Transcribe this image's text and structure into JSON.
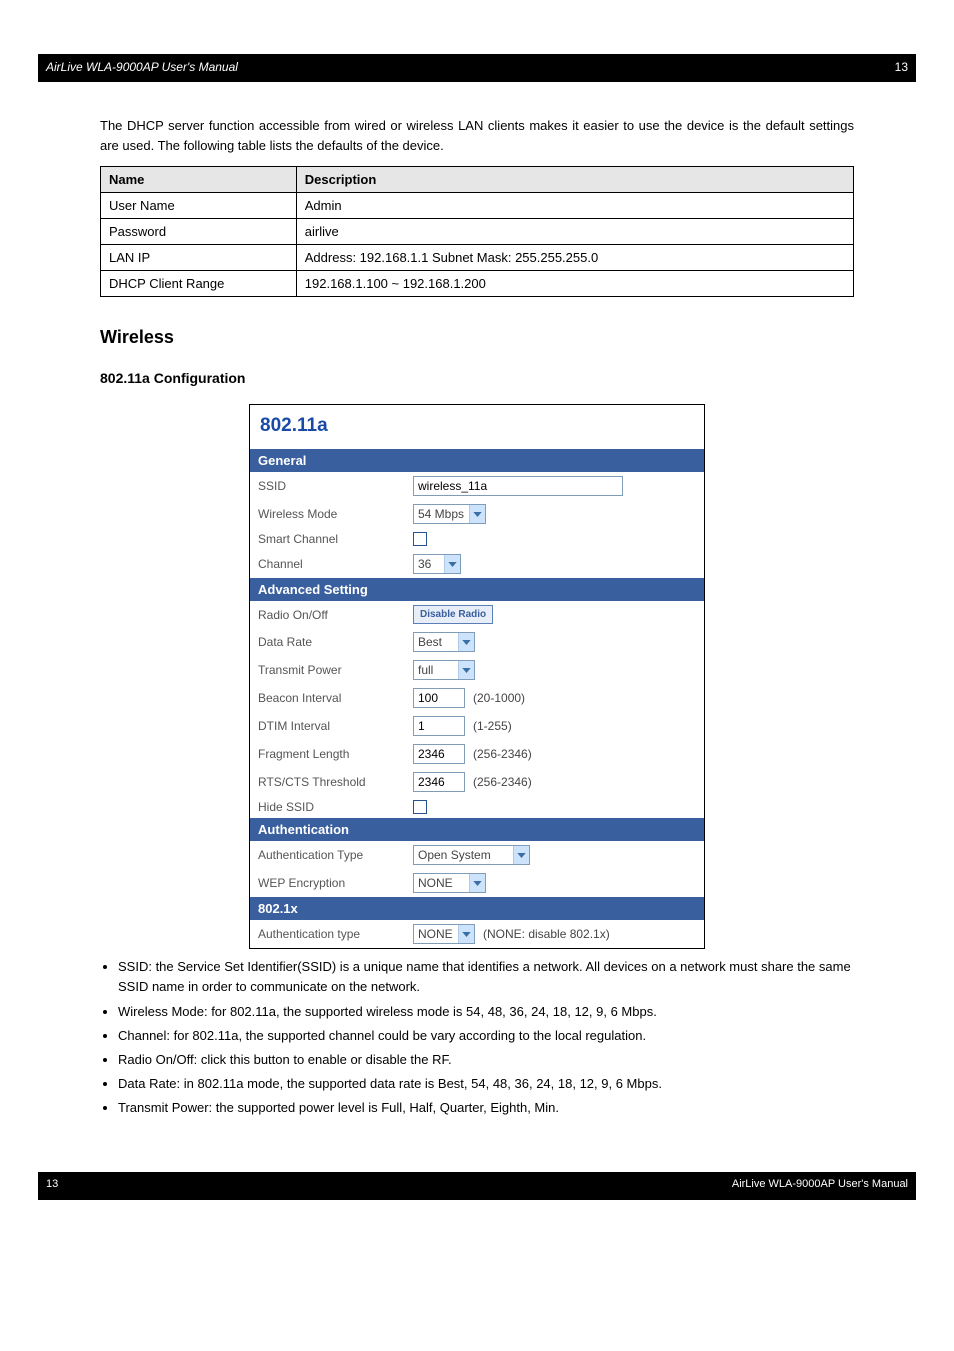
{
  "topbar": {
    "left": "AirLive WLA-9000AP User's Manual",
    "right": "13"
  },
  "bottombar": {
    "left": "13",
    "right": "AirLive WLA-9000AP User's Manual"
  },
  "intro_para": "The DHCP server function accessible from wired or wireless LAN clients makes it easier to use the device is the default settings are used. The following table lists the defaults of the device.",
  "table": {
    "headers": [
      "Name",
      "Description"
    ],
    "rows": [
      [
        "User Name",
        "Admin"
      ],
      [
        "Password",
        "airlive"
      ],
      [
        "LAN IP",
        "Address: 192.168.1.1 Subnet Mask: 255.255.255.0"
      ],
      [
        "DHCP Client Range",
        "192.168.1.100 ~ 192.168.1.200"
      ]
    ]
  },
  "headings": {
    "wireless": "Wireless",
    "a": "802.11a Configuration"
  },
  "panel": {
    "title": "802.11a",
    "sections": {
      "general": {
        "head": "General",
        "rows": {
          "ssid_lbl": "SSID",
          "ssid_val": "wireless_11a",
          "mode_lbl": "Wireless Mode",
          "mode_val": "54 Mbps",
          "smart_lbl": "Smart Channel",
          "chan_lbl": "Channel",
          "chan_val": "36"
        }
      },
      "advanced": {
        "head": "Advanced Setting",
        "rows": {
          "radio_lbl": "Radio On/Off",
          "radio_btn": "Disable Radio",
          "rate_lbl": "Data Rate",
          "rate_val": "Best",
          "power_lbl": "Transmit Power",
          "power_val": "full",
          "beacon_lbl": "Beacon Interval",
          "beacon_val": "100",
          "beacon_note": "(20-1000)",
          "dtim_lbl": "DTIM Interval",
          "dtim_val": "1",
          "dtim_note": "(1-255)",
          "frag_lbl": "Fragment Length",
          "frag_val": "2346",
          "frag_note": "(256-2346)",
          "rts_lbl": "RTS/CTS Threshold",
          "rts_val": "2346",
          "rts_note": "(256-2346)",
          "hide_lbl": "Hide SSID"
        }
      },
      "auth": {
        "head": "Authentication",
        "rows": {
          "authtype_lbl": "Authentication Type",
          "authtype_val": "Open System",
          "wep_lbl": "WEP Encryption",
          "wep_val": "NONE"
        }
      },
      "dot1x": {
        "head": "802.1x",
        "rows": {
          "authtype_lbl": "Authentication type",
          "authtype_val": "NONE",
          "authtype_note": "(NONE: disable 802.1x)"
        }
      }
    }
  },
  "bullets": [
    "SSID: the Service Set Identifier(SSID) is a unique name that identifies a network. All devices on a network must share the same SSID name in order to communicate on the network.",
    "Wireless Mode: for 802.11a, the supported wireless mode is 54, 48, 36, 24, 18, 12, 9, 6 Mbps.",
    "Channel: for 802.11a, the supported channel could be vary according to the local regulation.",
    "Radio On/Off: click this button to enable or disable the RF.",
    "Data Rate: in 802.11a mode, the supported data rate is Best, 54, 48, 36, 24, 18, 12, 9, 6 Mbps.",
    "Transmit Power: the supported power level is Full, Half, Quarter, Eighth, Min."
  ]
}
